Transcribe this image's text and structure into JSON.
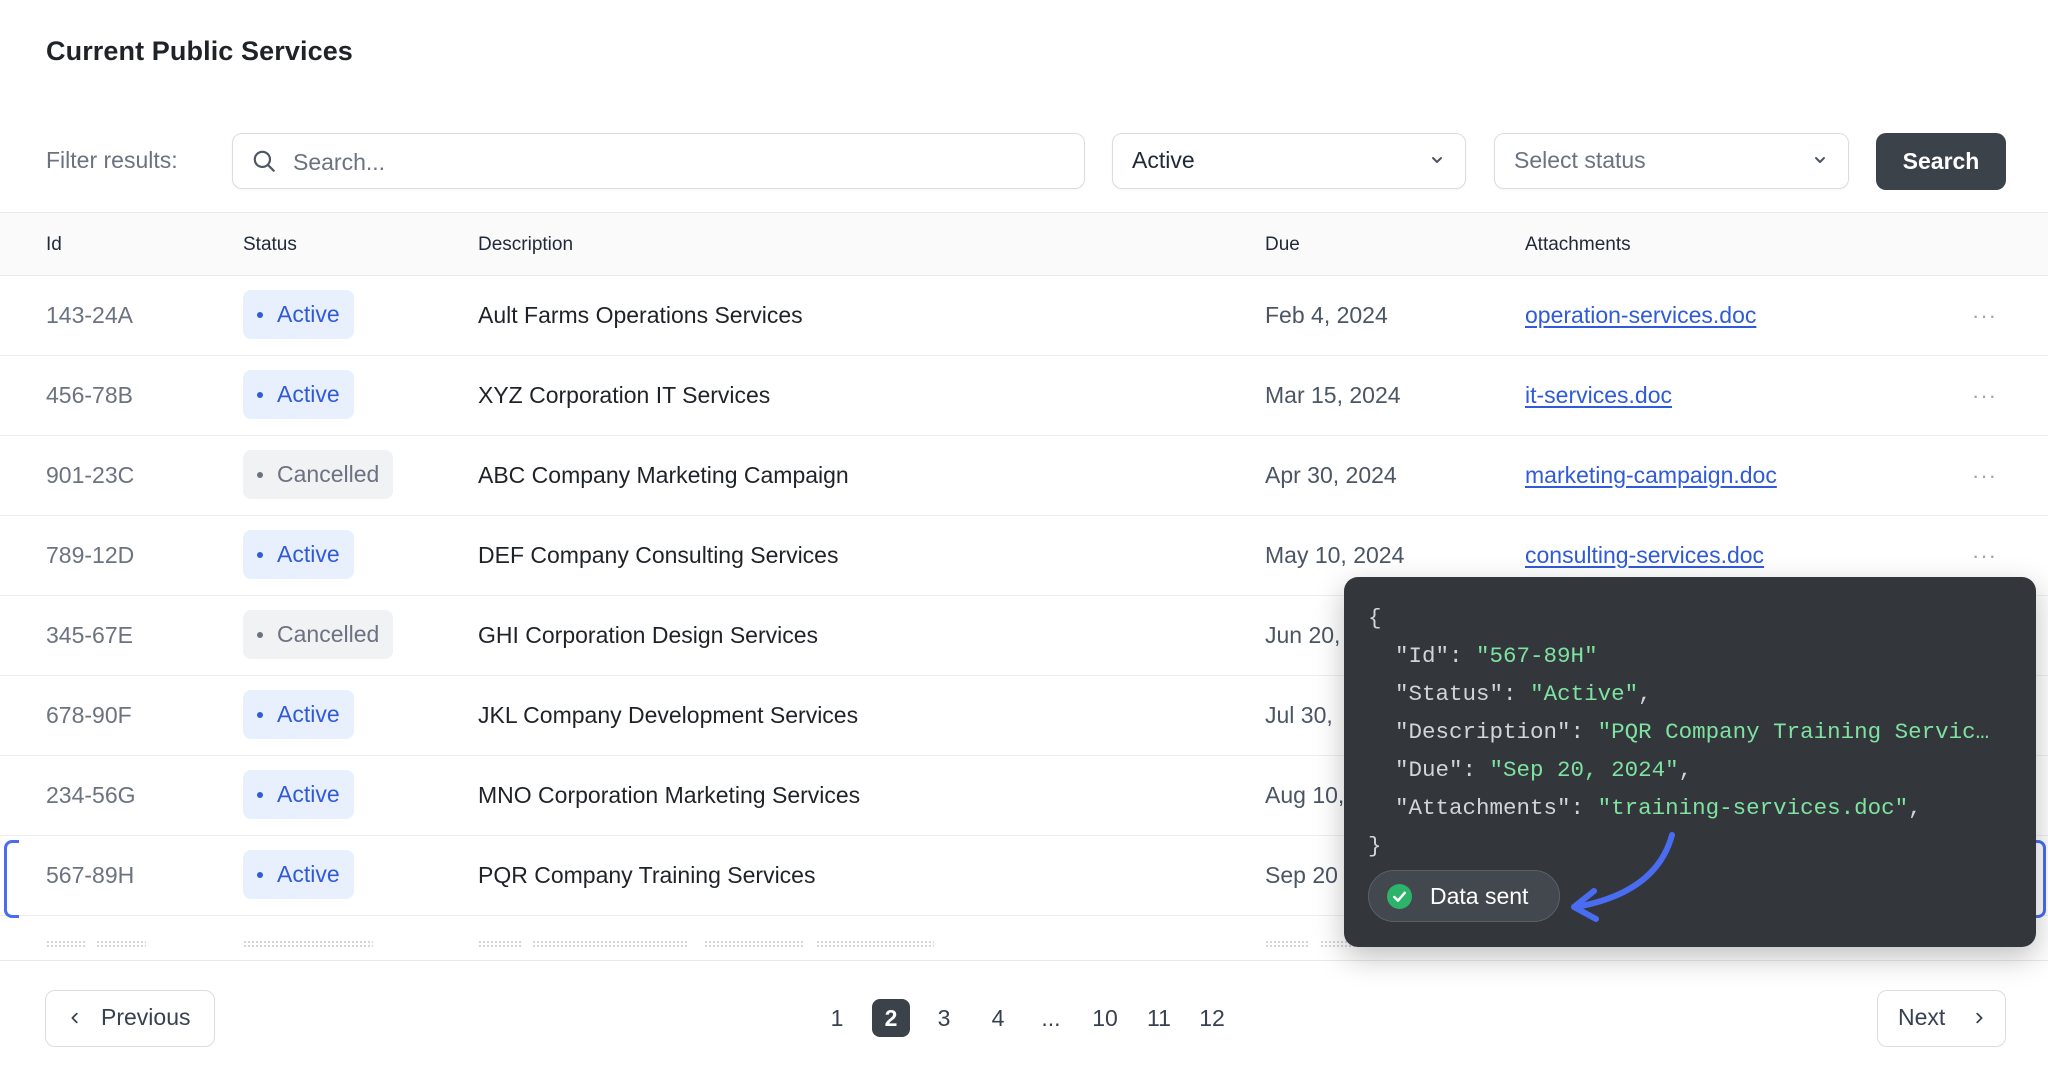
{
  "page": {
    "title": "Current Public Services"
  },
  "filter": {
    "label": "Filter results:",
    "search_placeholder": "Search...",
    "select1_value": "Active",
    "select2_placeholder": "Select status",
    "search_button": "Search"
  },
  "table": {
    "headers": [
      "Id",
      "Status",
      "Description",
      "Due",
      "Attachments"
    ],
    "rows": [
      {
        "id": "143-24A",
        "status": "Active",
        "description": "Ault Farms Operations Services",
        "due": "Feb 4, 2024",
        "attachment": "operation-services.doc"
      },
      {
        "id": "456-78B",
        "status": "Active",
        "description": "XYZ Corporation IT Services",
        "due": "Mar 15, 2024",
        "attachment": "it-services.doc"
      },
      {
        "id": "901-23C",
        "status": "Cancelled",
        "description": "ABC Company Marketing Campaign",
        "due": "Apr 30, 2024",
        "attachment": "marketing-campaign.doc"
      },
      {
        "id": "789-12D",
        "status": "Active",
        "description": "DEF Company Consulting Services",
        "due": "May 10, 2024",
        "attachment": "consulting-services.doc"
      },
      {
        "id": "345-67E",
        "status": "Cancelled",
        "description": "GHI Corporation Design Services",
        "due": "Jun 20,",
        "attachment": ""
      },
      {
        "id": "678-90F",
        "status": "Active",
        "description": "JKL Company Development Services",
        "due": "Jul 30,",
        "attachment": ""
      },
      {
        "id": "234-56G",
        "status": "Active",
        "description": "MNO Corporation Marketing Services",
        "due": "Aug 10,",
        "attachment": ""
      },
      {
        "id": "567-89H",
        "status": "Active",
        "description": "PQR Company Training Services",
        "due": "Sep 20",
        "attachment": ""
      }
    ],
    "more_glyph": "···"
  },
  "popup": {
    "open_brace": "{",
    "close_brace": "}",
    "fields": [
      {
        "key": "\"Id\"",
        "value": "\"567-89H\"",
        "trail": ""
      },
      {
        "key": "\"Status\"",
        "value": "\"Active\"",
        "trail": ","
      },
      {
        "key": "\"Description\"",
        "value": "\"PQR Company Training Servic…",
        "trail": ""
      },
      {
        "key": "\"Due\"",
        "value": "\"Sep 20, 2024\"",
        "trail": ","
      },
      {
        "key": "\"Attachments\"",
        "value": "\"training-services.doc\"",
        "trail": ","
      }
    ],
    "status_label": "Data sent"
  },
  "pagination": {
    "previous": "Previous",
    "next": "Next",
    "pages": [
      "1",
      "2",
      "3",
      "4",
      "...",
      "10",
      "11",
      "12"
    ],
    "current": "2"
  },
  "colors": {
    "accent": "#2f5bd8",
    "dark_button": "#3b4249",
    "popup_bg": "#33373c",
    "json_value": "#7ee2a0",
    "success": "#2db46b"
  }
}
